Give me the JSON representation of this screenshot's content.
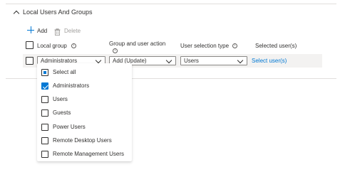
{
  "section": {
    "title": "Local Users And Groups"
  },
  "toolbar": {
    "add_label": "Add",
    "delete_label": "Delete"
  },
  "table": {
    "headers": {
      "local_group": "Local group",
      "group_action": "Group and user action",
      "user_selection_type": "User selection type",
      "selected_users": "Selected user(s)"
    },
    "row": {
      "local_group_value": "Administrators",
      "action_value": "Add (Update)",
      "selection_type_value": "Users",
      "select_users_link": "Select user(s)"
    }
  },
  "dropdown_menu": {
    "items": [
      {
        "label": "Select all",
        "state": "indeterminate"
      },
      {
        "label": "Administrators",
        "state": "checked"
      },
      {
        "label": "Users",
        "state": "unchecked"
      },
      {
        "label": "Guests",
        "state": "unchecked"
      },
      {
        "label": "Power Users",
        "state": "unchecked"
      },
      {
        "label": "Remote Desktop Users",
        "state": "unchecked"
      },
      {
        "label": "Remote Management Users",
        "state": "unchecked"
      }
    ]
  },
  "colors": {
    "accent": "#0078d4",
    "link": "#0078d4",
    "disabled": "#a19f9d",
    "border": "#8a8886"
  },
  "icons": {
    "collapse": "chevron-up-icon",
    "add": "plus-icon",
    "delete": "trash-icon",
    "info": "info-icon"
  }
}
